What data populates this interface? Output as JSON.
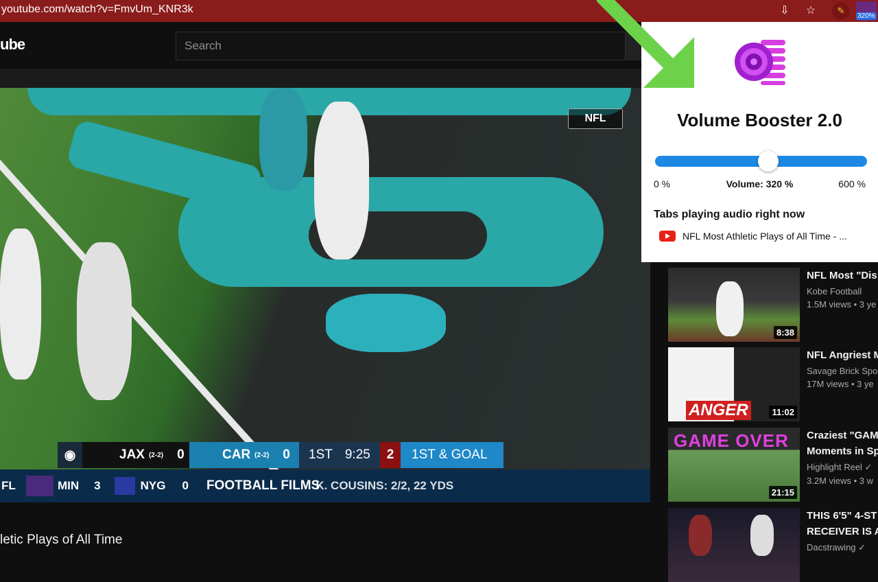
{
  "browser": {
    "url": "youtube.com/watch?v=FmvUm_KNR3k",
    "extension_badge": "320%"
  },
  "youtube": {
    "logo_fragment": "ube",
    "search_placeholder": "Search",
    "video_title_fragment": "letic Plays of All Time",
    "overlay_watermark": "NFL",
    "scoreboard": {
      "team1": "JAX",
      "team1_record": "(2-2)",
      "team1_score": "0",
      "team2": "CAR",
      "team2_record": "(2-2)",
      "team2_score": "0",
      "quarter": "1ST",
      "clock": "9:25",
      "down_num": "2",
      "down_text": "1ST & GOAL"
    },
    "ticker": {
      "left": "FL",
      "team_a": "MIN",
      "team_a_score": "3",
      "team_b": "NYG",
      "team_b_score": "0",
      "overlay_text": "FOOTBALL FILMS",
      "stat": "K. COUSINS: 2/2, 22 YDS"
    }
  },
  "popup": {
    "title": "Volume Booster 2.0",
    "slider_min": "0 %",
    "slider_value_label": "Volume: 320 %",
    "slider_max": "600 %",
    "slider_fraction": 0.533,
    "tabs_heading": "Tabs playing audio right now",
    "tab_item": "NFL Most Athletic Plays of All Time - ..."
  },
  "suggestions": [
    {
      "title": "NFL Most \"Dis",
      "channel": "Kobe Football",
      "views": "1.5M views • 3 ye",
      "duration": "8:38"
    },
    {
      "title": "NFL Angriest M",
      "channel": "Savage Brick Spo",
      "views": "17M views • 3 ye",
      "duration": "11:02",
      "thumb_text": "ANGER"
    },
    {
      "title": "Craziest \"GAM",
      "title2": "Moments in Sp",
      "channel": "Highlight Reel ✓",
      "views": "3.2M views • 3 w",
      "duration": "21:15",
      "thumb_text": "GAME OVER"
    },
    {
      "title": "THIS 6'5\" 4-ST",
      "title2": "RECEIVER IS A",
      "channel": "Dacstrawing ✓",
      "views": ""
    }
  ],
  "colors": {
    "chrome_bar": "#8b1c1c",
    "slider": "#1e88e5",
    "arrow": "#6cd24a",
    "yt_red": "#e62117"
  }
}
